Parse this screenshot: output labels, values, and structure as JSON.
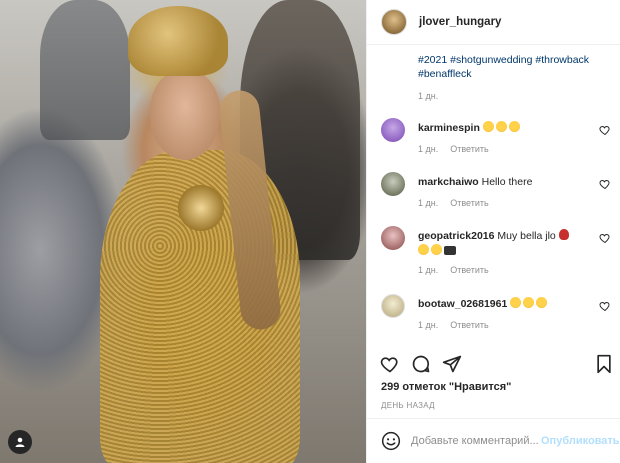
{
  "post": {
    "username": "jlover_hungary",
    "caption_tags": "#2021 #shotgunwedding #throwback #benaffleck",
    "caption_time": "1 дн.",
    "likes": "299 отметок \"Нравится\"",
    "date": "ДЕНЬ НАЗАД"
  },
  "comments": [
    {
      "username": "karminespin",
      "text": "",
      "emoji": [
        "star-struck-emoji",
        "star-struck-emoji",
        "star-struck-emoji"
      ],
      "time": "1 дн.",
      "reply": "Ответить",
      "avatar_color": "#8b5fbf"
    },
    {
      "username": "markchaiwo",
      "text": "Hello there",
      "emoji": [],
      "time": "1 дн.",
      "reply": "Ответить",
      "avatar_color": "#9aa08c"
    },
    {
      "username": "geopatrick2016",
      "text": "Muy bella jlo",
      "emoji": [
        "rose-emoji",
        "heart-eyes-emoji",
        "star-struck-emoji",
        "clapper-board-emoji"
      ],
      "time": "1 дн.",
      "reply": "Ответить",
      "avatar_color": "#c48a8a"
    },
    {
      "username": "bootaw_02681961",
      "text": "",
      "emoji": [
        "star-struck-emoji",
        "smiling-emoji",
        "star-struck-emoji"
      ],
      "time": "1 дн.",
      "reply": "Ответить",
      "avatar_color": "#e6ddb8"
    }
  ],
  "add_comment": {
    "placeholder": "Добавьте комментарий...",
    "post_label": "Опубликовать"
  },
  "icons": {
    "heart": "heart-icon",
    "comment": "comment-icon",
    "share": "share-icon",
    "save": "bookmark-icon",
    "emoji": "emoji-icon",
    "tags": "user-tag-icon"
  }
}
